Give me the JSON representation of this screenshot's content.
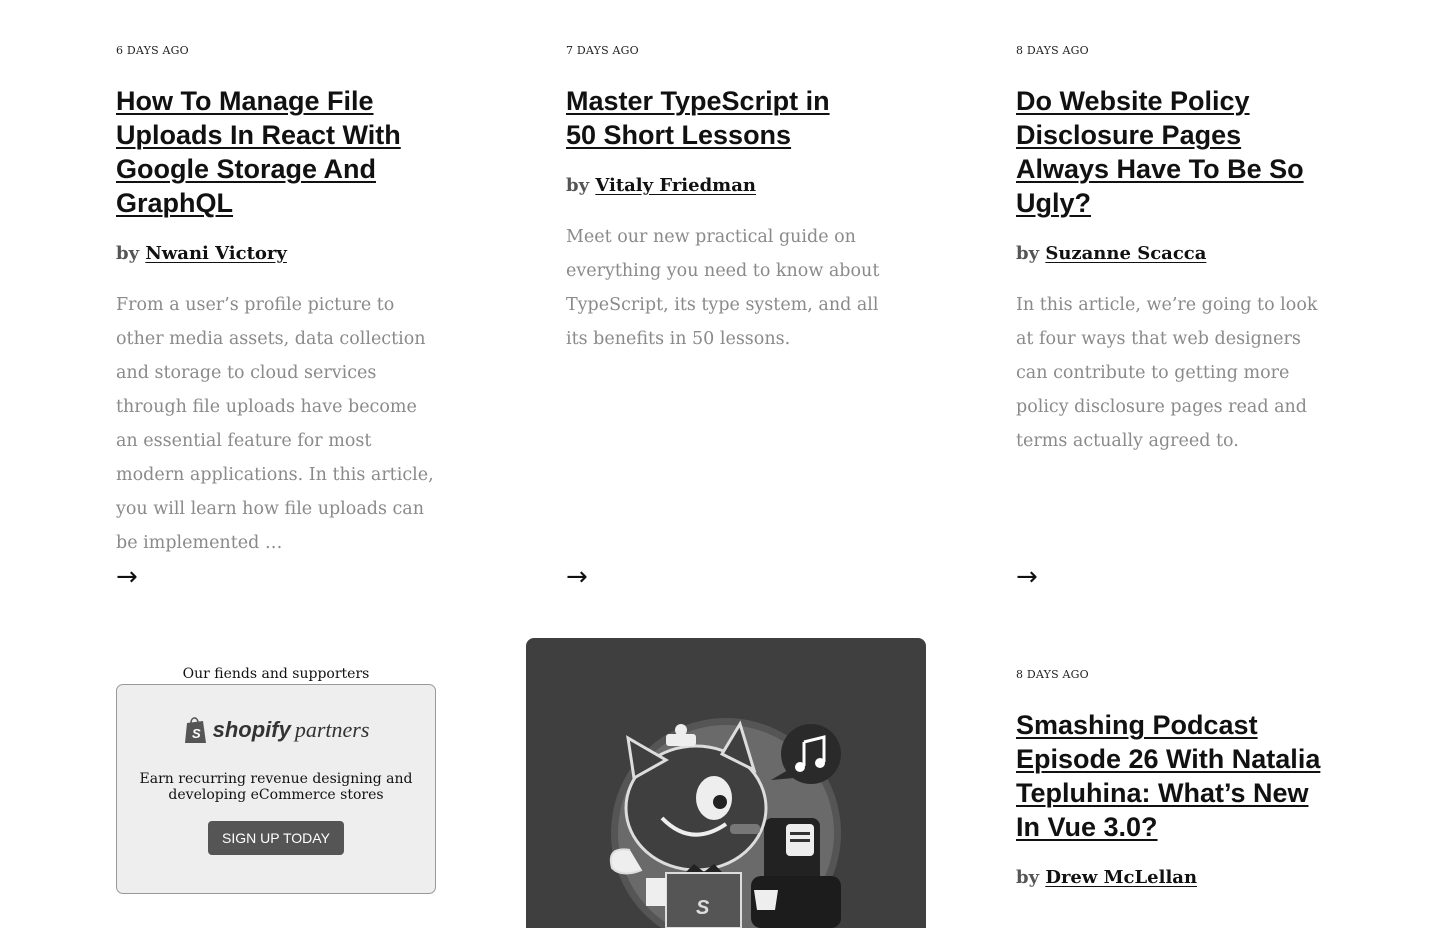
{
  "articles": [
    {
      "date": "6 DAYS AGO",
      "title": "How To Manage File Uploads In React With Google Storage And GraphQL",
      "by": "by",
      "author": "Nwani Victory",
      "excerpt": "From a user’s profile picture to other media assets, data collection and storage to cloud services through file uploads have become an essential feature for most modern applications. In this article, you will learn how file uploads can be implemented …"
    },
    {
      "date": "7 DAYS AGO",
      "title": "Master TypeScript in 50 Short Lessons",
      "by": "by",
      "author": "Vitaly Friedman",
      "excerpt": "Meet our new practical guide on everything you need to know about TypeScript, its type system, and all its benefits in 50 lessons."
    },
    {
      "date": "8 DAYS AGO",
      "title": "Do Website Policy Disclosure Pages Always Have To Be So Ugly?",
      "by": "by",
      "author": "Suzanne Scacca",
      "excerpt": "In this article, we’re going to look at four ways that web designers can contribute to getting more policy disclosure pages read and terms actually agreed to."
    },
    {
      "date": "8 DAYS AGO",
      "title": "Smashing Podcast Episode 26 With Natalia Tepluhina: What’s New In Vue 3.0?",
      "by": "by",
      "author": "Drew McLellan"
    }
  ],
  "arrow_glyph": "→",
  "sponsor": {
    "heading": "Our fiends and supporters",
    "brand": "shopify",
    "brand_suffix": "partners",
    "text": "Earn recurring revenue designing and developing eCommerce stores",
    "button": "SIGN UP TODAY"
  },
  "promo": {
    "bg_color": "#3f3f3f",
    "icon": "smashing-cat-podcast-illustration"
  }
}
